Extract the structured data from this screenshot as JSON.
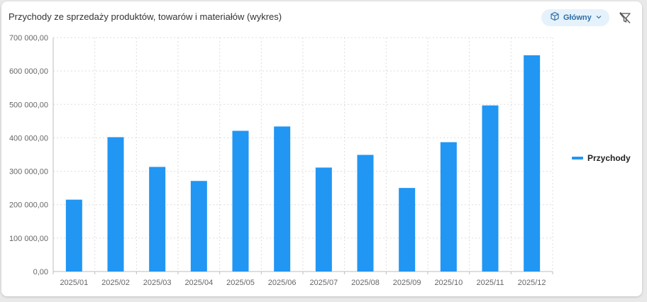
{
  "header": {
    "title": "Przychody ze sprzedaży produktów, towarów i materiałów (wykres)",
    "dashboard_label": "Główny"
  },
  "icons": {
    "dashboard": "dashboard-cube-icon",
    "dropdown": "chevron-down-icon",
    "filter": "filter-off-icon"
  },
  "colors": {
    "bar": "#2196f3",
    "accent": "#2e6ea6"
  },
  "chart_data": {
    "type": "bar",
    "categories": [
      "2025/01",
      "2025/02",
      "2025/03",
      "2025/04",
      "2025/05",
      "2025/06",
      "2025/07",
      "2025/08",
      "2025/09",
      "2025/10",
      "2025/11",
      "2025/12"
    ],
    "series": [
      {
        "name": "Przychody",
        "values": [
          215000,
          402000,
          313000,
          271000,
          421000,
          434000,
          311000,
          349000,
          250000,
          387000,
          497000,
          647000
        ]
      }
    ],
    "ylim": [
      0,
      700000
    ],
    "yticks": [
      0,
      100000,
      200000,
      300000,
      400000,
      500000,
      600000,
      700000
    ],
    "ytick_labels": [
      "0,00",
      "100 000,00",
      "200 000,00",
      "300 000,00",
      "400 000,00",
      "500 000,00",
      "600 000,00",
      "700 000,00"
    ],
    "grid": true,
    "legend": "right"
  }
}
